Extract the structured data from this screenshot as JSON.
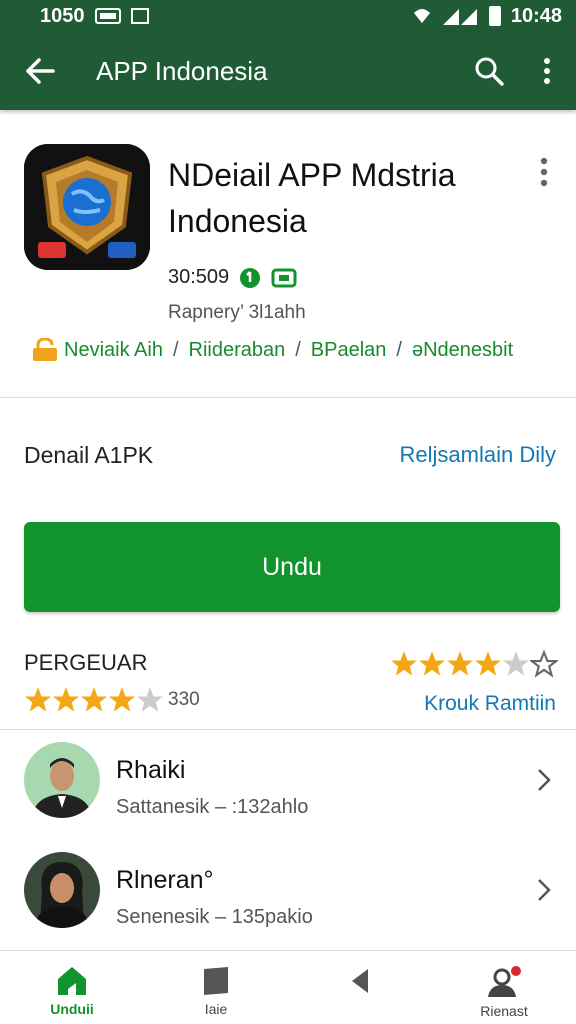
{
  "status_bar": {
    "time_left": "1050",
    "time_right": "10:48"
  },
  "app_bar": {
    "title": "APP Indonesia",
    "icons": [
      "back-arrow-icon",
      "search-icon",
      "more-vert-icon"
    ]
  },
  "app_header": {
    "name": "NDeiail APP Mdstria Indonesia",
    "meta": "30:509",
    "sub": "Rapnery’ 3l1ahh",
    "breadcrumbs": [
      "Neviaik Aih",
      "Riideraban",
      "BPaelan",
      "əNdenesbit"
    ]
  },
  "detail": {
    "title": "Denail A1PK",
    "link": "Reljsamlain Dily"
  },
  "download_button": {
    "label": "Undu"
  },
  "rating": {
    "label": "PERGEUAR",
    "top_stars": 4,
    "bottom_stars": 4,
    "count": "330",
    "link": "Krouk Ramtiin"
  },
  "reviews": [
    {
      "name": "Rhaiki",
      "sub": "Sattanesik – :132ahlo"
    },
    {
      "name": "Rlneran°",
      "sub": "Senenesik – 135pakio"
    }
  ],
  "bottom_nav": [
    {
      "label": "Unduii",
      "icon": "home-icon",
      "active": true
    },
    {
      "label": "Iaie",
      "icon": "square-icon",
      "active": false
    },
    {
      "label": "",
      "icon": "back-triangle-icon",
      "active": false
    },
    {
      "label": "Rienast",
      "icon": "profile-icon",
      "active": false
    }
  ],
  "colors": {
    "primary_dark": "#1f5c35",
    "accent_green": "#11942d",
    "link_blue": "#1677b5",
    "star_gold": "#f3a712"
  }
}
